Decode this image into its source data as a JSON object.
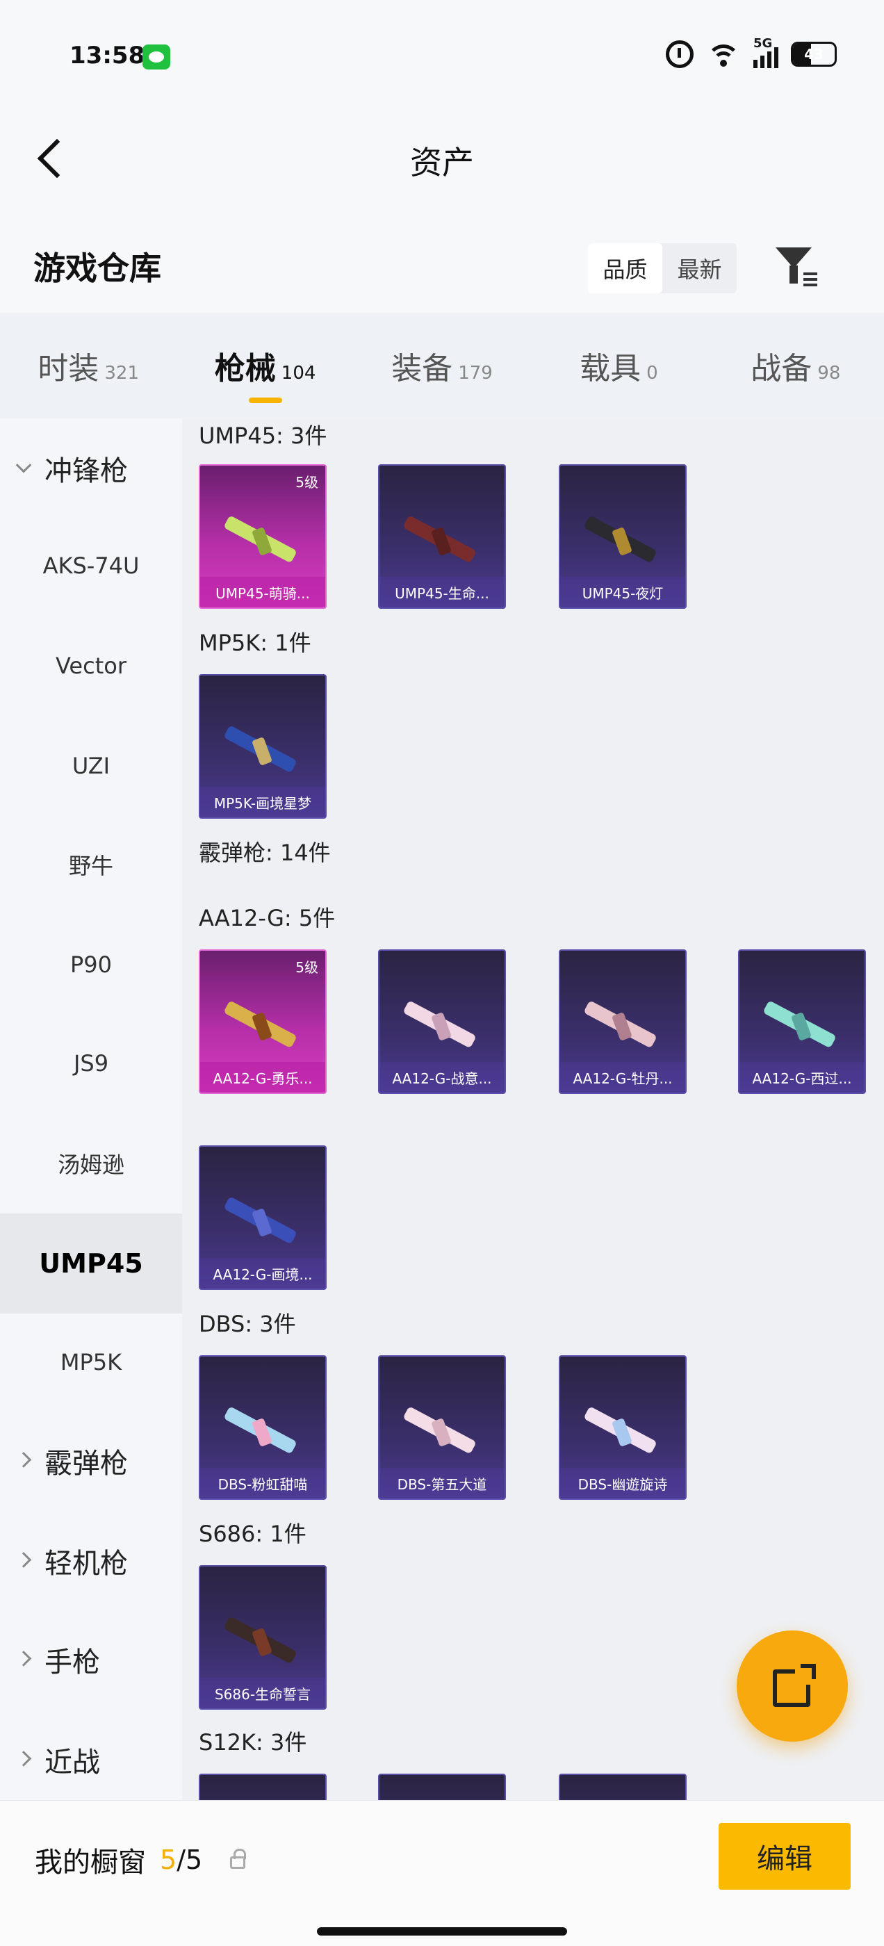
{
  "status_bar": {
    "time": "13:58",
    "network": "5G",
    "battery": "43"
  },
  "header": {
    "title": "资产"
  },
  "warehouse": {
    "title": "游戏仓库",
    "sort_options": [
      "品质",
      "最新"
    ]
  },
  "tabs": [
    {
      "name": "时装",
      "count": "321"
    },
    {
      "name": "枪械",
      "count": "104"
    },
    {
      "name": "装备",
      "count": "179"
    },
    {
      "name": "载具",
      "count": "0"
    },
    {
      "name": "战备",
      "count": "98"
    }
  ],
  "side_menu": {
    "group_open": "冲锋枪",
    "items": [
      "AKS-74U",
      "Vector",
      "UZI",
      "野牛",
      "P90",
      "JS9",
      "汤姆逊",
      "UMP45",
      "MP5K"
    ],
    "groups_closed": [
      "霰弹枪",
      "轻机枪",
      "手枪",
      "近战"
    ]
  },
  "content": {
    "sections": [
      {
        "label": "UMP45: 3件",
        "cards": [
          {
            "name": "UMP45-萌骑...",
            "level": "5级"
          },
          {
            "name": "UMP45-生命..."
          },
          {
            "name": "UMP45-夜灯"
          }
        ]
      },
      {
        "label": "MP5K: 1件",
        "cards": [
          {
            "name": "MP5K-画境星梦"
          }
        ]
      },
      {
        "label": "霰弹枪: 14件"
      },
      {
        "label": "AA12-G: 5件",
        "cards": [
          {
            "name": "AA12-G-勇乐...",
            "level": "5级"
          },
          {
            "name": "AA12-G-战意..."
          },
          {
            "name": "AA12-G-牡丹..."
          },
          {
            "name": "AA12-G-西过..."
          },
          {
            "name": "AA12-G-画境..."
          }
        ]
      },
      {
        "label": "DBS: 3件",
        "cards": [
          {
            "name": "DBS-粉虹甜喵"
          },
          {
            "name": "DBS-第五大道"
          },
          {
            "name": "DBS-幽遊旋诗"
          }
        ]
      },
      {
        "label": "S686: 1件",
        "cards": [
          {
            "name": "S686-生命誓言"
          }
        ]
      },
      {
        "label": "S12K: 3件"
      }
    ]
  },
  "bottom_bar": {
    "showcase_label": "我的橱窗",
    "showcase_current": "5",
    "showcase_total": "/5",
    "edit_label": "编辑"
  },
  "colors": {
    "accent": "#f6b400",
    "card_purple": "#3b2f6b",
    "card_gold": "#b52fa8"
  },
  "icons": [
    "back-arrow-icon",
    "filter-icon",
    "lock-icon",
    "external-link-icon",
    "wechat-icon",
    "alarm-icon",
    "wifi-icon",
    "signal-icon",
    "battery-icon"
  ]
}
